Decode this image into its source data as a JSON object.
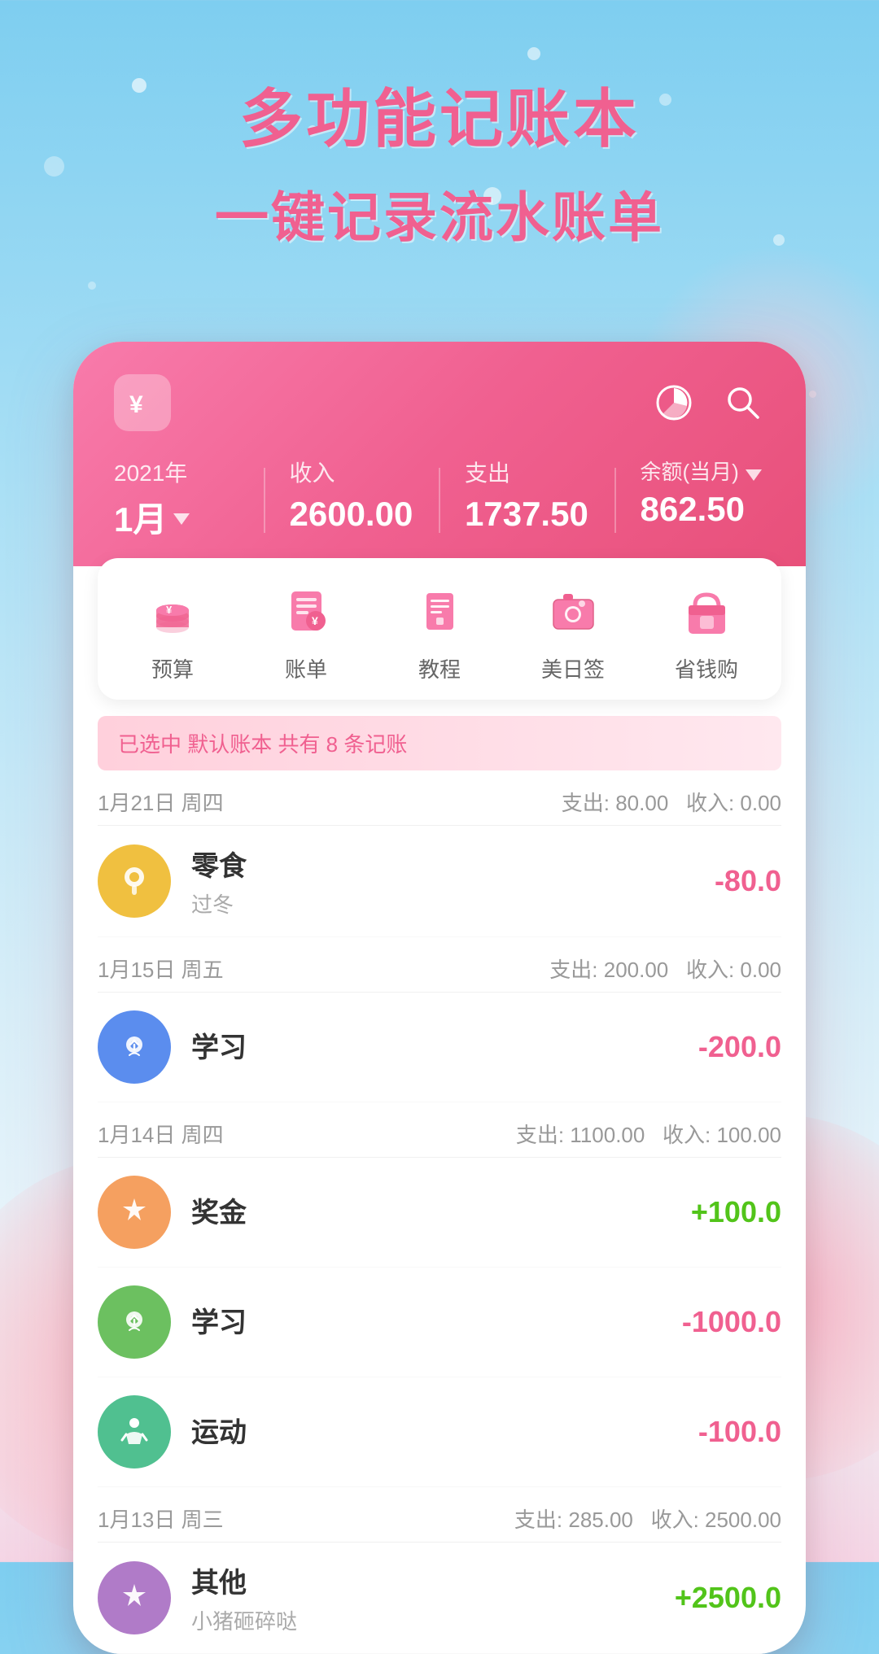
{
  "background": {
    "gradient_start": "#7ecef0",
    "gradient_end": "#f5d5e5"
  },
  "hero": {
    "title1": "多功能记账本",
    "title2": "一键记录流水账单"
  },
  "app": {
    "year": "2021年",
    "income_label": "收入",
    "expense_label": "支出",
    "balance_label": "余额(当月)",
    "month": "1月",
    "income_value": "2600.00",
    "expense_value": "1737.50",
    "balance_value": "862.50"
  },
  "menu": {
    "items": [
      {
        "label": "预算",
        "icon": "budget"
      },
      {
        "label": "账单",
        "icon": "bill"
      },
      {
        "label": "教程",
        "icon": "tutorial"
      },
      {
        "label": "美日签",
        "icon": "photo"
      },
      {
        "label": "省钱购",
        "icon": "shop"
      }
    ]
  },
  "section": {
    "text": "已选中 默认账本 共有 8 条记账"
  },
  "transactions": [
    {
      "date": "1月21日 周四",
      "expense": "80.00",
      "income": "0.00",
      "items": [
        {
          "name": "零食",
          "note": "过冬",
          "amount": "-80.0",
          "positive": false,
          "color": "#f0c040",
          "icon": "snack"
        }
      ]
    },
    {
      "date": "1月15日 周五",
      "expense": "200.00",
      "income": "0.00",
      "items": [
        {
          "name": "学习",
          "note": "",
          "amount": "-200.0",
          "positive": false,
          "color": "#5b8dee",
          "icon": "study"
        }
      ]
    },
    {
      "date": "1月14日 周四",
      "expense": "1100.00",
      "income": "100.00",
      "items": [
        {
          "name": "奖金",
          "note": "",
          "amount": "+100.0",
          "positive": true,
          "color": "#f5a060",
          "icon": "bonus"
        },
        {
          "name": "学习",
          "note": "",
          "amount": "-1000.0",
          "positive": false,
          "color": "#6cc060",
          "icon": "study2"
        },
        {
          "name": "运动",
          "note": "",
          "amount": "-100.0",
          "positive": false,
          "color": "#50c090",
          "icon": "sport"
        }
      ]
    },
    {
      "date": "1月13日 周三",
      "expense": "285.00",
      "income": "2500.00",
      "items": [
        {
          "name": "其他",
          "note": "小猪砸碎哒",
          "amount": "+2500.0",
          "positive": true,
          "color": "#b07bc8",
          "icon": "other"
        }
      ]
    }
  ]
}
